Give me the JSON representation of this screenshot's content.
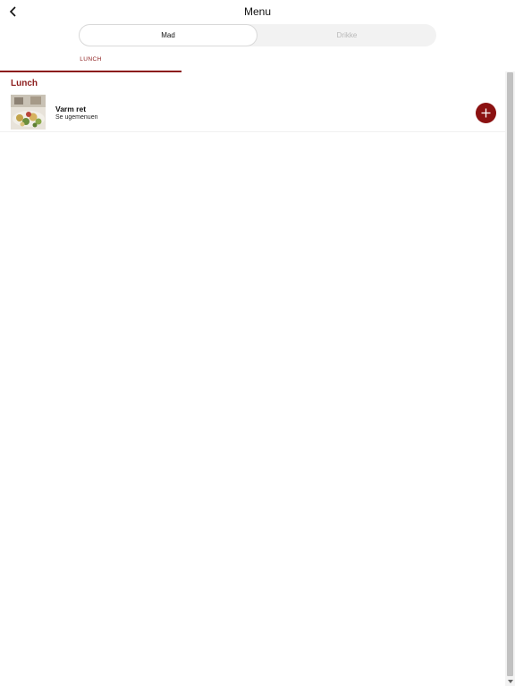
{
  "header": {
    "title": "Menu",
    "back_icon": "chevron-left-icon"
  },
  "segmented": {
    "options": [
      {
        "label": "Mad",
        "selected": true
      },
      {
        "label": "Drikke",
        "selected": false
      }
    ]
  },
  "categories": {
    "tabs": [
      {
        "label": "LUNCH",
        "selected": true
      }
    ]
  },
  "section": {
    "title": "Lunch",
    "items": [
      {
        "name": "Varm ret",
        "description": "Se ugemenuen",
        "thumb_icon": "food-photo-icon",
        "action_icon": "plus-icon"
      }
    ]
  },
  "colors": {
    "accent": "#8b1a1a",
    "add_button": "#8b1111",
    "inactive_text": "#b8b8b8"
  }
}
